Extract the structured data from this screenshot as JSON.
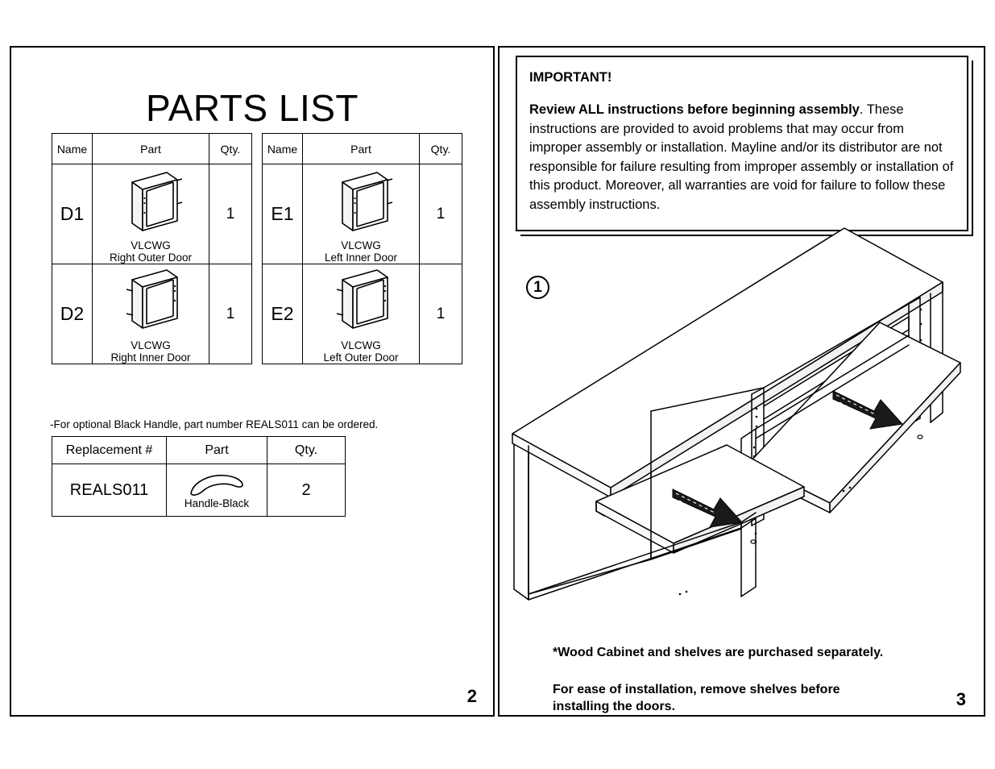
{
  "document": {
    "type": "assembly-instructions",
    "pages": [
      {
        "number": "2",
        "side": "left"
      },
      {
        "number": "3",
        "side": "right"
      }
    ]
  },
  "left_page": {
    "title": "PARTS LIST",
    "tables": [
      {
        "id": "parts-table-d",
        "headers": [
          "Name",
          "Part",
          "Qty."
        ],
        "rows": [
          {
            "name": "D1",
            "part_code": "VLCWG",
            "part_desc": "Right Outer Door",
            "qty": "1",
            "icon": "door-panel-icon"
          },
          {
            "name": "D2",
            "part_code": "VLCWG",
            "part_desc": "Right Inner Door",
            "qty": "1",
            "icon": "door-panel-icon"
          }
        ]
      },
      {
        "id": "parts-table-e",
        "headers": [
          "Name",
          "Part",
          "Qty."
        ],
        "rows": [
          {
            "name": "E1",
            "part_code": "VLCWG",
            "part_desc": "Left Inner Door",
            "qty": "1",
            "icon": "door-panel-icon"
          },
          {
            "name": "E2",
            "part_code": "VLCWG",
            "part_desc": "Left Outer Door",
            "qty": "1",
            "icon": "door-panel-icon"
          }
        ]
      }
    ],
    "handle_note": "-For optional Black Handle, part number REALS011 can be ordered.",
    "handle_table": {
      "headers": [
        "Replacement #",
        "Part",
        "Qty."
      ],
      "rows": [
        {
          "replacement": "REALS011",
          "part_desc": "Handle-Black",
          "qty": "2",
          "icon": "handle-curve-icon"
        }
      ]
    },
    "page_number": "2"
  },
  "right_page": {
    "important": {
      "heading": "IMPORTANT!",
      "lead": "Review ALL instructions before beginning assembly",
      "body": ". These instructions are provided to avoid problems that may occur from improper assembly or installation. Mayline and/or its distributor are not responsible for failure resulting from improper assembly or installation of this product. Moreover, all warranties are void for failure to follow these assembly instructions."
    },
    "step": {
      "number": "1",
      "illustration": "wood-cabinet-isometric-with-shelves"
    },
    "footer_notes": [
      "*Wood Cabinet and shelves are purchased separately.",
      "For ease of installation, remove shelves before installing the doors."
    ],
    "page_number": "3"
  },
  "colors": {
    "ink": "#000000",
    "paper": "#ffffff",
    "arrow_fill": "#1a1a1a"
  }
}
